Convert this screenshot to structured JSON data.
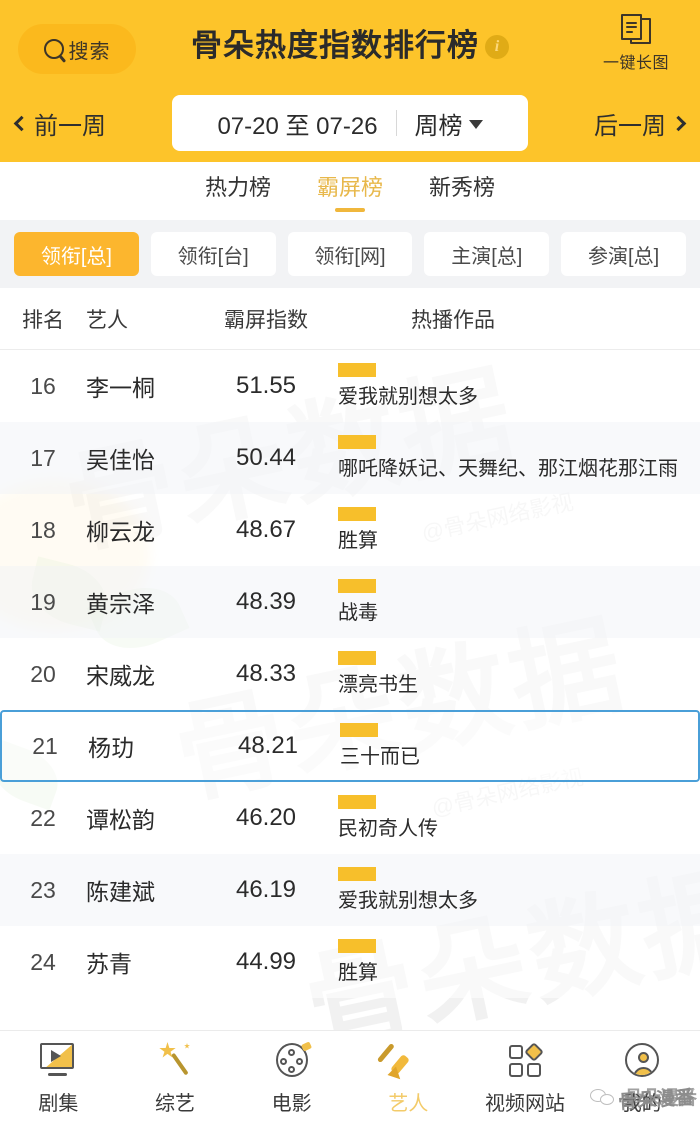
{
  "header": {
    "search_label": "搜索",
    "title": "骨朵热度指数排行榜",
    "info_symbol": "i",
    "long_image_label": "一键长图",
    "prev_week": "前一周",
    "next_week": "后一周",
    "date_range": "07-20 至 07-26",
    "period": "周榜"
  },
  "tabs": [
    {
      "label": "热力榜",
      "active": false
    },
    {
      "label": "霸屏榜",
      "active": true
    },
    {
      "label": "新秀榜",
      "active": false
    }
  ],
  "chips": [
    {
      "label": "领衔[总]",
      "active": true
    },
    {
      "label": "领衔[台]",
      "active": false
    },
    {
      "label": "领衔[网]",
      "active": false
    },
    {
      "label": "主演[总]",
      "active": false
    },
    {
      "label": "参演[总]",
      "active": false
    }
  ],
  "table": {
    "columns": [
      "排名",
      "艺人",
      "霸屏指数",
      "热播作品"
    ],
    "rows": [
      {
        "rank": "16",
        "artist": "李一桐",
        "index": "51.55",
        "work": "爱我就别想太多",
        "highlight": false
      },
      {
        "rank": "17",
        "artist": "吴佳怡",
        "index": "50.44",
        "work": "哪吒降妖记、天舞纪、那江烟花那江雨",
        "highlight": false
      },
      {
        "rank": "18",
        "artist": "柳云龙",
        "index": "48.67",
        "work": "胜算",
        "highlight": false
      },
      {
        "rank": "19",
        "artist": "黄宗泽",
        "index": "48.39",
        "work": "战毒",
        "highlight": false
      },
      {
        "rank": "20",
        "artist": "宋威龙",
        "index": "48.33",
        "work": "漂亮书生",
        "highlight": false
      },
      {
        "rank": "21",
        "artist": "杨玏",
        "index": "48.21",
        "work": "三十而已",
        "highlight": true
      },
      {
        "rank": "22",
        "artist": "谭松韵",
        "index": "46.20",
        "work": "民初奇人传",
        "highlight": false
      },
      {
        "rank": "23",
        "artist": "陈建斌",
        "index": "46.19",
        "work": "爱我就别想太多",
        "highlight": false
      },
      {
        "rank": "24",
        "artist": "苏青",
        "index": "44.99",
        "work": "胜算",
        "highlight": false
      }
    ]
  },
  "watermark": {
    "big": "骨朵数据",
    "small": "@骨朵网络影视",
    "wechat_name": "骨朵漫番"
  },
  "bottom_nav": [
    {
      "label": "剧集",
      "icon": "drama-icon",
      "active": false
    },
    {
      "label": "综艺",
      "icon": "magic-wand-icon",
      "active": false
    },
    {
      "label": "电影",
      "icon": "film-reel-icon",
      "active": false
    },
    {
      "label": "艺人",
      "icon": "brush-icon",
      "active": true
    },
    {
      "label": "视频网站",
      "icon": "grid-icon",
      "active": false
    },
    {
      "label": "我的",
      "icon": "user-icon",
      "active": false
    }
  ],
  "colors": {
    "brand_yellow": "#fdc42a",
    "chip_active": "#fcb62e",
    "tab_active": "#e8b84b",
    "highlight_border": "#4a9fd8",
    "work_bar": "#f7bf2b"
  }
}
